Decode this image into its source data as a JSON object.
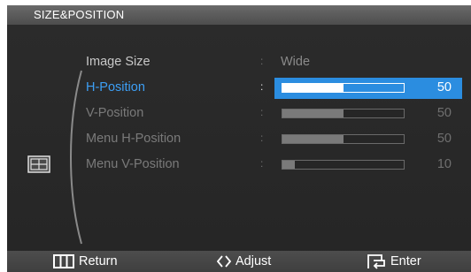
{
  "title": "SIZE&POSITION",
  "colors": {
    "accent": "#2b8de0",
    "selected_label": "#3d9ff5"
  },
  "menu": {
    "items": [
      {
        "label": "Image Size",
        "type": "value",
        "value": "Wide"
      },
      {
        "label": "H-Position",
        "type": "slider",
        "value": 50,
        "value_text": "50",
        "selected": true
      },
      {
        "label": "V-Position",
        "type": "slider",
        "value": 50,
        "value_text": "50"
      },
      {
        "label": "Menu H-Position",
        "type": "slider",
        "value": 50,
        "value_text": "50"
      },
      {
        "label": "Menu V-Position",
        "type": "slider",
        "value": 10,
        "value_text": "10"
      }
    ]
  },
  "footer": {
    "return_icon": "menu-icon",
    "return_label": "Return",
    "adjust_icon": "up-down-arrows-icon",
    "adjust_label": "Adjust",
    "enter_icon": "enter-source-icon",
    "enter_label": "Enter"
  },
  "side_icon": "size-position-icon"
}
